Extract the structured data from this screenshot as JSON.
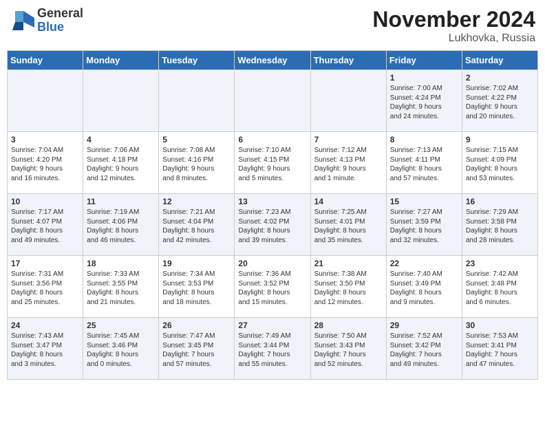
{
  "header": {
    "logo_general": "General",
    "logo_blue": "Blue",
    "month_year": "November 2024",
    "location": "Lukhovka, Russia"
  },
  "weekdays": [
    "Sunday",
    "Monday",
    "Tuesday",
    "Wednesday",
    "Thursday",
    "Friday",
    "Saturday"
  ],
  "weeks": [
    [
      {
        "day": "",
        "info": ""
      },
      {
        "day": "",
        "info": ""
      },
      {
        "day": "",
        "info": ""
      },
      {
        "day": "",
        "info": ""
      },
      {
        "day": "",
        "info": ""
      },
      {
        "day": "1",
        "info": "Sunrise: 7:00 AM\nSunset: 4:24 PM\nDaylight: 9 hours\nand 24 minutes."
      },
      {
        "day": "2",
        "info": "Sunrise: 7:02 AM\nSunset: 4:22 PM\nDaylight: 9 hours\nand 20 minutes."
      }
    ],
    [
      {
        "day": "3",
        "info": "Sunrise: 7:04 AM\nSunset: 4:20 PM\nDaylight: 9 hours\nand 16 minutes."
      },
      {
        "day": "4",
        "info": "Sunrise: 7:06 AM\nSunset: 4:18 PM\nDaylight: 9 hours\nand 12 minutes."
      },
      {
        "day": "5",
        "info": "Sunrise: 7:08 AM\nSunset: 4:16 PM\nDaylight: 9 hours\nand 8 minutes."
      },
      {
        "day": "6",
        "info": "Sunrise: 7:10 AM\nSunset: 4:15 PM\nDaylight: 9 hours\nand 5 minutes."
      },
      {
        "day": "7",
        "info": "Sunrise: 7:12 AM\nSunset: 4:13 PM\nDaylight: 9 hours\nand 1 minute."
      },
      {
        "day": "8",
        "info": "Sunrise: 7:13 AM\nSunset: 4:11 PM\nDaylight: 8 hours\nand 57 minutes."
      },
      {
        "day": "9",
        "info": "Sunrise: 7:15 AM\nSunset: 4:09 PM\nDaylight: 8 hours\nand 53 minutes."
      }
    ],
    [
      {
        "day": "10",
        "info": "Sunrise: 7:17 AM\nSunset: 4:07 PM\nDaylight: 8 hours\nand 49 minutes."
      },
      {
        "day": "11",
        "info": "Sunrise: 7:19 AM\nSunset: 4:06 PM\nDaylight: 8 hours\nand 46 minutes."
      },
      {
        "day": "12",
        "info": "Sunrise: 7:21 AM\nSunset: 4:04 PM\nDaylight: 8 hours\nand 42 minutes."
      },
      {
        "day": "13",
        "info": "Sunrise: 7:23 AM\nSunset: 4:02 PM\nDaylight: 8 hours\nand 39 minutes."
      },
      {
        "day": "14",
        "info": "Sunrise: 7:25 AM\nSunset: 4:01 PM\nDaylight: 8 hours\nand 35 minutes."
      },
      {
        "day": "15",
        "info": "Sunrise: 7:27 AM\nSunset: 3:59 PM\nDaylight: 8 hours\nand 32 minutes."
      },
      {
        "day": "16",
        "info": "Sunrise: 7:29 AM\nSunset: 3:58 PM\nDaylight: 8 hours\nand 28 minutes."
      }
    ],
    [
      {
        "day": "17",
        "info": "Sunrise: 7:31 AM\nSunset: 3:56 PM\nDaylight: 8 hours\nand 25 minutes."
      },
      {
        "day": "18",
        "info": "Sunrise: 7:33 AM\nSunset: 3:55 PM\nDaylight: 8 hours\nand 21 minutes."
      },
      {
        "day": "19",
        "info": "Sunrise: 7:34 AM\nSunset: 3:53 PM\nDaylight: 8 hours\nand 18 minutes."
      },
      {
        "day": "20",
        "info": "Sunrise: 7:36 AM\nSunset: 3:52 PM\nDaylight: 8 hours\nand 15 minutes."
      },
      {
        "day": "21",
        "info": "Sunrise: 7:38 AM\nSunset: 3:50 PM\nDaylight: 8 hours\nand 12 minutes."
      },
      {
        "day": "22",
        "info": "Sunrise: 7:40 AM\nSunset: 3:49 PM\nDaylight: 8 hours\nand 9 minutes."
      },
      {
        "day": "23",
        "info": "Sunrise: 7:42 AM\nSunset: 3:48 PM\nDaylight: 8 hours\nand 6 minutes."
      }
    ],
    [
      {
        "day": "24",
        "info": "Sunrise: 7:43 AM\nSunset: 3:47 PM\nDaylight: 8 hours\nand 3 minutes."
      },
      {
        "day": "25",
        "info": "Sunrise: 7:45 AM\nSunset: 3:46 PM\nDaylight: 8 hours\nand 0 minutes."
      },
      {
        "day": "26",
        "info": "Sunrise: 7:47 AM\nSunset: 3:45 PM\nDaylight: 7 hours\nand 57 minutes."
      },
      {
        "day": "27",
        "info": "Sunrise: 7:49 AM\nSunset: 3:44 PM\nDaylight: 7 hours\nand 55 minutes."
      },
      {
        "day": "28",
        "info": "Sunrise: 7:50 AM\nSunset: 3:43 PM\nDaylight: 7 hours\nand 52 minutes."
      },
      {
        "day": "29",
        "info": "Sunrise: 7:52 AM\nSunset: 3:42 PM\nDaylight: 7 hours\nand 49 minutes."
      },
      {
        "day": "30",
        "info": "Sunrise: 7:53 AM\nSunset: 3:41 PM\nDaylight: 7 hours\nand 47 minutes."
      }
    ]
  ]
}
